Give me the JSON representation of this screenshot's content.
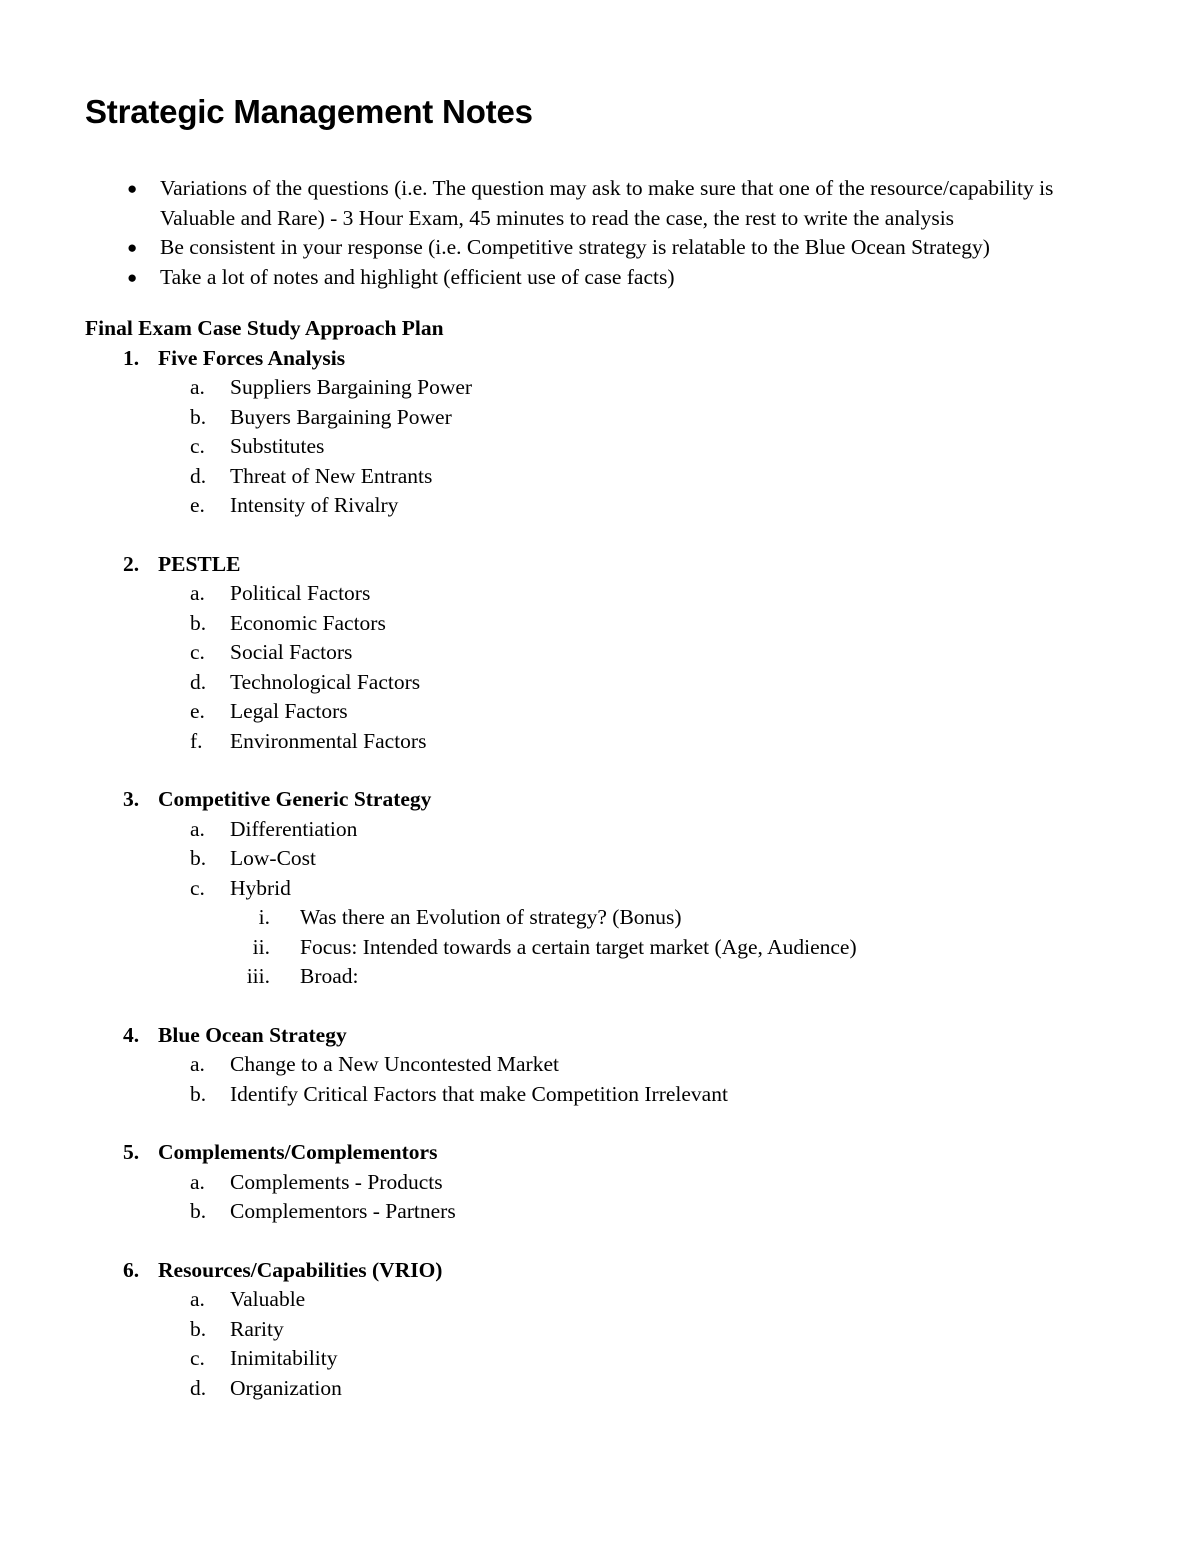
{
  "document": {
    "title": "Strategic Management Notes",
    "intro_bullets": [
      "Variations of the questions (i.e. The question may ask to make sure that one of the resource/capability is Valuable and Rare) - 3 Hour Exam, 45 minutes to read the case, the rest to write the analysis",
      "Be consistent in your response (i.e. Competitive strategy is relatable to the Blue Ocean Strategy)",
      "Take a lot of notes and highlight (efficient use of case facts)"
    ],
    "section_heading": "Final Exam Case Study Approach Plan",
    "outline": [
      {
        "number": "1.",
        "title": "Five Forces Analysis",
        "items": [
          {
            "marker": "a.",
            "text": "Suppliers Bargaining Power"
          },
          {
            "marker": "b.",
            "text": "Buyers Bargaining Power"
          },
          {
            "marker": "c.",
            "text": "Substitutes"
          },
          {
            "marker": "d.",
            "text": "Threat of New Entrants"
          },
          {
            "marker": "e.",
            "text": "Intensity of Rivalry"
          }
        ]
      },
      {
        "number": "2.",
        "title": "PESTLE",
        "items": [
          {
            "marker": "a.",
            "text": "Political Factors"
          },
          {
            "marker": "b.",
            "text": "Economic Factors"
          },
          {
            "marker": "c.",
            "text": "Social Factors"
          },
          {
            "marker": "d.",
            "text": "Technological Factors"
          },
          {
            "marker": "e.",
            "text": "Legal Factors"
          },
          {
            "marker": "f.",
            "text": "Environmental Factors"
          }
        ]
      },
      {
        "number": "3.",
        "title": "Competitive Generic Strategy",
        "items": [
          {
            "marker": "a.",
            "text": "Differentiation"
          },
          {
            "marker": "b.",
            "text": "Low-Cost"
          },
          {
            "marker": "c.",
            "text": "Hybrid",
            "subitems": [
              {
                "marker": "i.",
                "text": "Was there an Evolution of strategy? (Bonus)"
              },
              {
                "marker": "ii.",
                "text": "Focus: Intended towards a certain target market (Age, Audience)"
              },
              {
                "marker": "iii.",
                "text": "Broad:"
              }
            ]
          }
        ]
      },
      {
        "number": "4.",
        "title": "Blue Ocean Strategy",
        "items": [
          {
            "marker": "a.",
            "text": "Change to a New Uncontested Market"
          },
          {
            "marker": "b.",
            "text": "Identify Critical Factors that make Competition Irrelevant"
          }
        ]
      },
      {
        "number": "5.",
        "title": "Complements/Complementors",
        "items": [
          {
            "marker": "a.",
            "text": "Complements - Products"
          },
          {
            "marker": "b.",
            "text": "Complementors - Partners"
          }
        ]
      },
      {
        "number": "6.",
        "title": "Resources/Capabilities (VRIO)",
        "items": [
          {
            "marker": "a.",
            "text": "Valuable"
          },
          {
            "marker": "b.",
            "text": "Rarity"
          },
          {
            "marker": "c.",
            "text": "Inimitability"
          },
          {
            "marker": "d.",
            "text": "Organization"
          }
        ]
      }
    ],
    "bullet_glyph": "●",
    "colors": {
      "text": "#000000",
      "background": "#ffffff"
    }
  }
}
